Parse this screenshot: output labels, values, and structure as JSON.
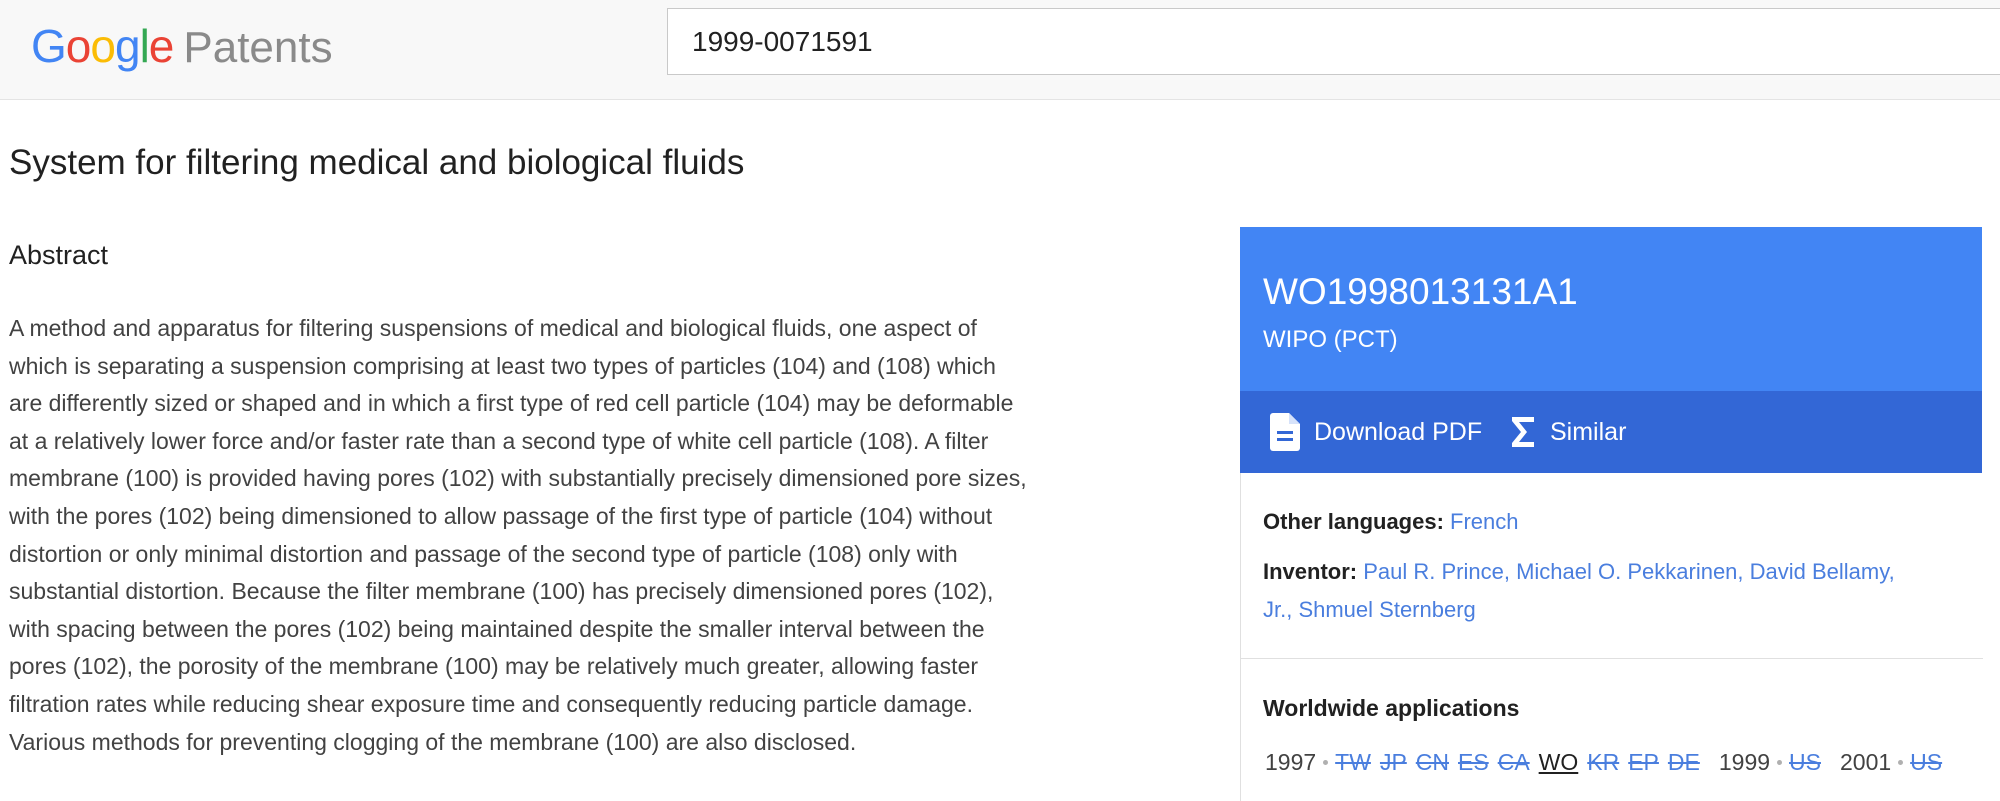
{
  "header": {
    "brand_g": [
      "G",
      "o",
      "o",
      "g",
      "l",
      "e"
    ],
    "brand_product": "Patents",
    "search_value": "1999-0071591"
  },
  "patent": {
    "title": "System for filtering medical and biological fluids",
    "abstract_heading": "Abstract",
    "abstract_lines": [
      "A method and apparatus for filtering suspensions of medical and biological fluids, one aspect of",
      "which is separating a suspension comprising at least two types of particles (104) and (108) which",
      "are differently sized or shaped and in which a first type of red cell particle (104) may be deformable",
      "at a relatively lower force and/or faster rate than a second type of white cell particle (108). A filter",
      "membrane (100) is provided having pores (102) with substantially precisely dimensioned pore sizes,",
      "with the pores (102) being dimensioned to allow passage of the first type of particle (104) without",
      "distortion or only minimal distortion and passage of the second type of particle (108) only with",
      "substantial distortion. Because the filter membrane (100) has precisely dimensioned pores (102),",
      "with spacing between the pores (102) being maintained despite the smaller interval between the",
      "pores (102), the porosity of the membrane (100) may be relatively much greater, allowing faster",
      "filtration rates while reducing shear exposure time and consequently reducing particle damage.",
      "Various methods for preventing clogging of the membrane (100) are also disclosed."
    ]
  },
  "card": {
    "number": "WO1998013131A1",
    "office": "WIPO (PCT)",
    "download_label": "Download PDF",
    "download_icon": "document-icon",
    "similar_label": "Similar",
    "similar_icon": "sigma-icon",
    "other_languages_label": "Other languages:",
    "other_languages_value": "French",
    "inventor_label": "Inventor:",
    "inventor_line1": "Paul R. Prince, Michael O. Pekkarinen, David Bellamy,",
    "inventor_line2": "Jr., Shmuel Sternberg",
    "worldwide_heading": "Worldwide applications",
    "worldwide": [
      {
        "year": "1997",
        "countries": [
          "TW",
          "JP",
          "CN",
          "ES",
          "CA",
          "WO",
          "KR",
          "EP",
          "DE"
        ],
        "current": "WO"
      },
      {
        "year": "1999",
        "countries": [
          "US"
        ],
        "current": ""
      },
      {
        "year": "2001",
        "countries": [
          "US"
        ],
        "current": ""
      }
    ]
  },
  "colors": {
    "brand_blue": "#4285f4",
    "action_bar": "#3367d6",
    "link": "#4a7ede"
  }
}
